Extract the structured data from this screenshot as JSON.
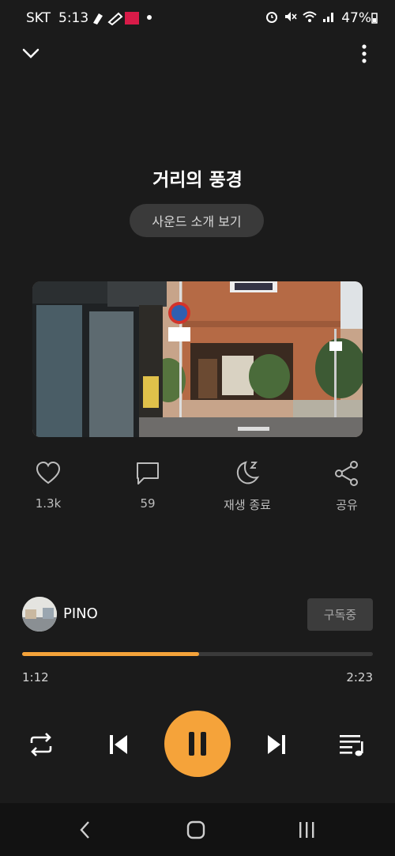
{
  "status_bar": {
    "carrier": "SKT",
    "time": "5:13",
    "battery": "47%"
  },
  "track": {
    "title": "거리의 풍경",
    "intro_label": "사운드 소개 보기"
  },
  "actions": {
    "likes": "1.3k",
    "comments": "59",
    "sleep_timer": "재생 종료",
    "share": "공유"
  },
  "creator": {
    "name": "PINO",
    "subscribe_label": "구독중"
  },
  "player": {
    "current_time": "1:12",
    "total_time": "2:23",
    "progress_fraction": 0.504
  },
  "colors": {
    "accent": "#f5a33a",
    "background": "#1b1b1b"
  },
  "icons": {
    "collapse": "chevron-down-icon",
    "more": "more-vertical-icon",
    "like": "heart-icon",
    "comment": "comment-icon",
    "sleep": "moon-icon",
    "share": "share-icon",
    "repeat": "repeat-icon",
    "previous": "skip-previous-icon",
    "pause": "pause-icon",
    "next": "skip-next-icon",
    "playlist": "playlist-icon"
  }
}
